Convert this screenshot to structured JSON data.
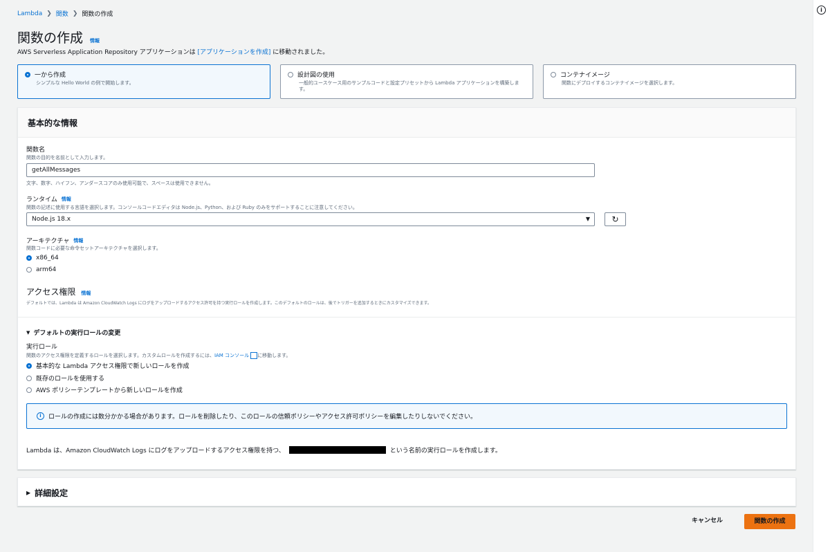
{
  "breadcrumb": [
    "Lambda",
    "関数",
    "関数の作成"
  ],
  "page": {
    "title": "関数の作成",
    "info_label": "情報",
    "subtitle_pre": "AWS Serverless Application Repository アプリケーションは ",
    "subtitle_link": "[アプリケーションを作成]",
    "subtitle_post": " に移動されました。"
  },
  "options": [
    {
      "label": "一から作成",
      "desc": "シンプルな Hello World の例で開始します。",
      "selected": true
    },
    {
      "label": "設計図の使用",
      "desc": "一般的ユースケース用のサンプルコードと設定プリセットから Lambda アプリケーションを構築します。",
      "selected": false
    },
    {
      "label": "コンテナイメージ",
      "desc": "関数にデプロイするコンテナイメージを選択します。",
      "selected": false
    }
  ],
  "basic": {
    "header": "基本的な情報",
    "fn_label": "関数名",
    "fn_desc": "関数の目的を名前として入力します。",
    "fn_value": "getAllMessages",
    "fn_hint": "文字、数字、ハイフン、アンダースコアのみ使用可能で、スペースは使用できません。",
    "rt_label": "ランタイム",
    "rt_desc": "関数の記述に使用する言語を選択します。コンソールコードエディタは Node.js、Python、および Ruby のみをサポートすることに注意してください。",
    "rt_value": "Node.js 18.x",
    "arch_label": "アーキテクチャ",
    "arch_desc": "関数コードに必要な命令セットアーキテクチャを選択します。",
    "arch_options": [
      "x86_64",
      "arm64"
    ],
    "perm_title": "アクセス権限",
    "perm_desc": "デフォルトでは、Lambda は Amazon CloudWatch Logs にログをアップロードするアクセス許可を持つ実行ロールを作成します。このデフォルトのロールは、後でトリガーを追加するときにカスタマイズできます。",
    "role_toggle": "デフォルトの実行ロールの変更",
    "role_label": "実行ロール",
    "role_desc_pre": "関数のアクセス権限を定義するロールを選択します。カスタムロールを作成するには、",
    "role_desc_link": "IAM コンソール",
    "role_desc_post": "に移動します。",
    "role_options": [
      "基本的な Lambda アクセス権限で新しいロールを作成",
      "既存のロールを使用する",
      "AWS ポリシーテンプレートから新しいロールを作成"
    ],
    "alert_text": "ロールの作成には数分かかる場合があります。ロールを削除したり、このロールの信頼ポリシーやアクセス許可ポリシーを編集したりしないでください。",
    "footer_pre": "Lambda は、Amazon CloudWatch Logs にログをアップロードするアクセス権限を持つ、",
    "footer_post": "という名前の実行ロールを作成します。"
  },
  "advanced": {
    "header": "詳細設定"
  },
  "actions": {
    "cancel": "キャンセル",
    "create": "関数の作成"
  },
  "colors": {
    "accent": "#0972d3",
    "primary_button": "#ec7211"
  }
}
